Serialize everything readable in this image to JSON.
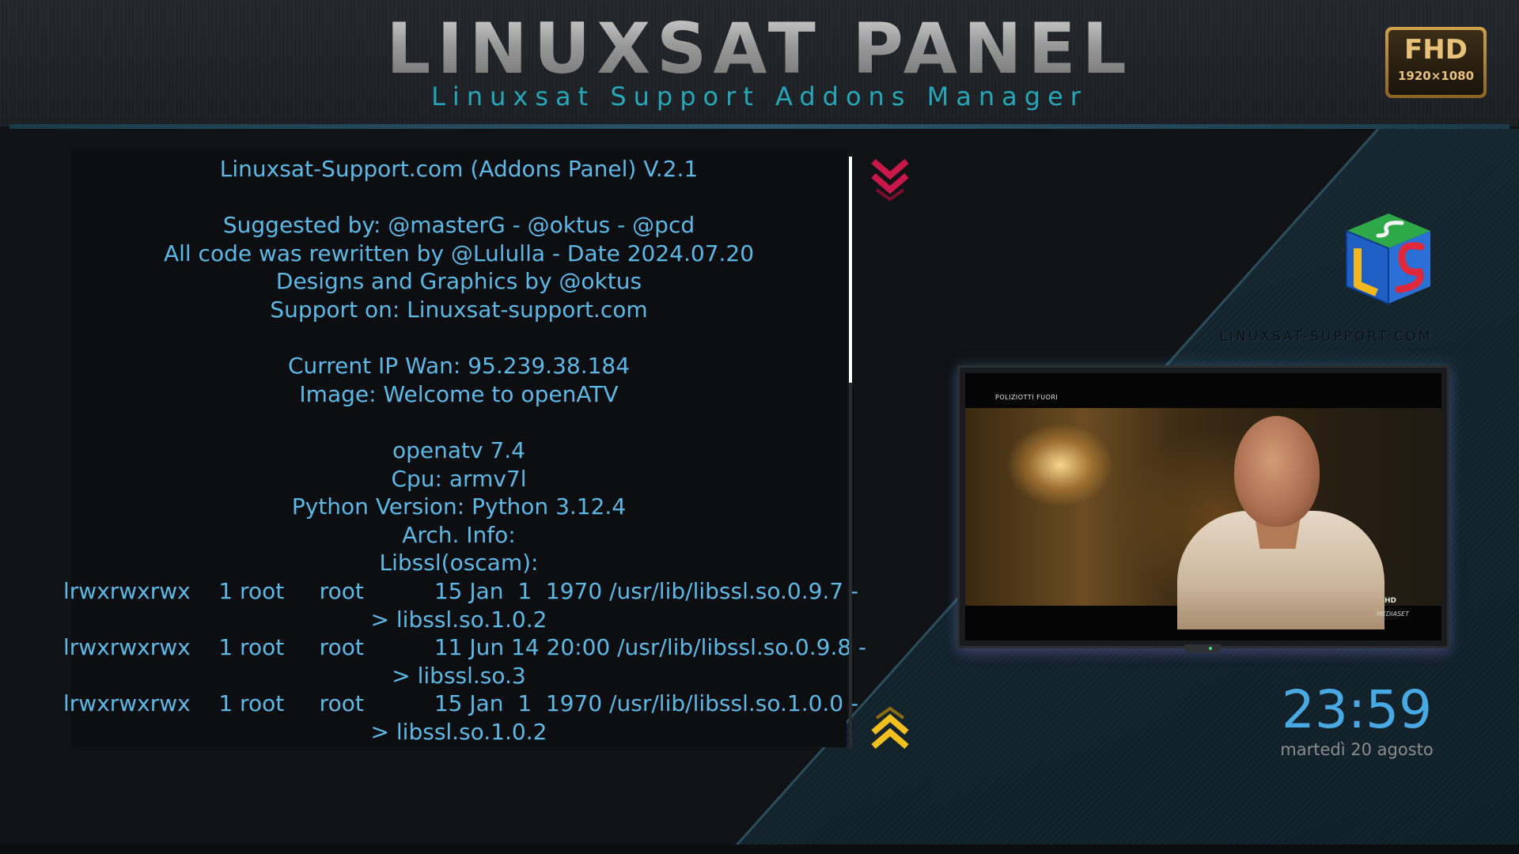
{
  "header": {
    "title": "LINUXSAT PANEL",
    "subtitle": "Linuxsat Support Addons Manager",
    "badge_main": "FHD",
    "badge_sub": "1920×1080"
  },
  "info": {
    "lines": [
      "Linuxsat-Support.com (Addons Panel) V.2.1",
      "",
      "Suggested by: @masterG - @oktus - @pcd",
      "All code was rewritten by @Lululla - Date 2024.07.20",
      "Designs and Graphics by @oktus",
      "Support on: Linuxsat-support.com",
      "",
      "Current IP Wan: 95.239.38.184",
      "Image: Welcome to openATV",
      "",
      "openatv 7.4",
      "Cpu: armv7l",
      "Python Version: Python 3.12.4",
      "Arch. Info:",
      "Libssl(oscam):",
      "lrwxrwxrwx    1 root     root          15 Jan  1  1970 /usr/lib/libssl.so.0.9.7 -",
      "> libssl.so.1.0.2",
      "lrwxrwxrwx    1 root     root          11 Jun 14 20:00 /usr/lib/libssl.so.0.9.8 -",
      "> libssl.so.3",
      "lrwxrwxrwx    1 root     root          15 Jan  1  1970 /usr/lib/libssl.so.1.0.0 -",
      "> libssl.so.1.0.2"
    ],
    "text_color": "#5cb9e6"
  },
  "scroll": {
    "down_icon": "double-chevron-down-icon",
    "up_icon": "double-chevron-up-icon",
    "down_color": "#c8184a",
    "up_color": "#f2c01e",
    "position_fraction": 0.38
  },
  "logo": {
    "icon": "ls-cube-logo",
    "caption": "LINUXSAT-SUPPORT.COM"
  },
  "tv": {
    "channel_label": "POLIZIOTTI FUORI",
    "broadcaster": "MEDIASET",
    "hd_badge": "HD"
  },
  "clock": {
    "time": "23:59",
    "date": "martedì 20 agosto",
    "color": "#49a9e4"
  },
  "colors": {
    "accent": "#25a7b8",
    "background": "#101216"
  }
}
